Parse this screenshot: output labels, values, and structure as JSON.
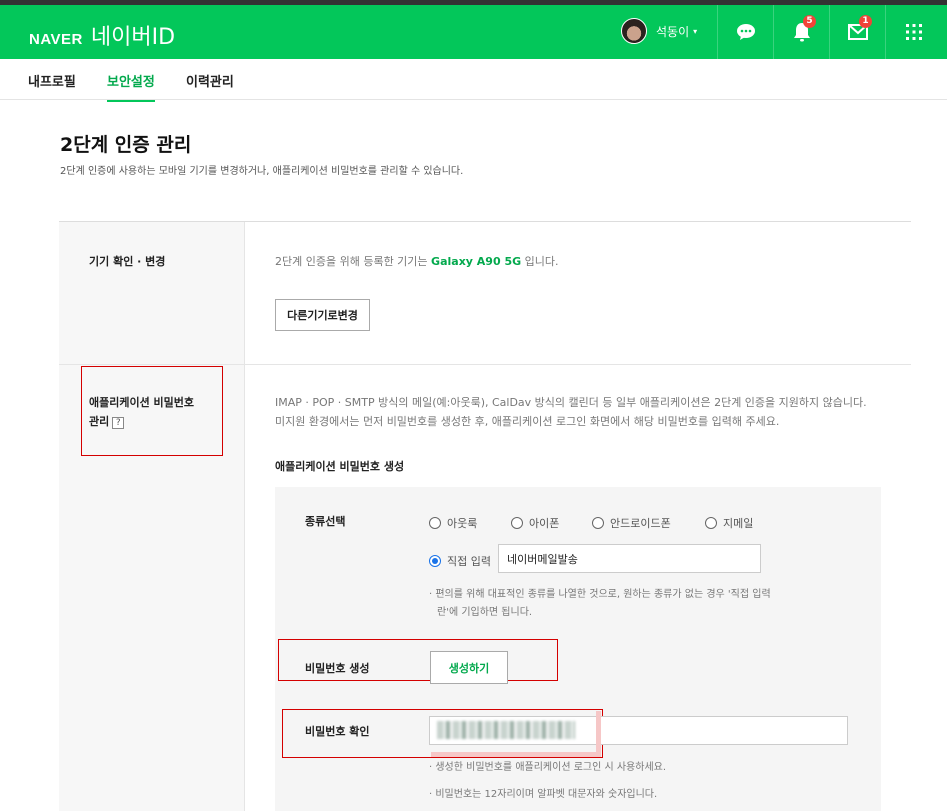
{
  "header": {
    "brand": "NAVER",
    "product": "네이버ID",
    "user_name": "석동이",
    "talk_badge": "",
    "notification_badge": "5",
    "mail_badge": "1",
    "colors": {
      "brand_green": "#03c75a",
      "badge_red": "#f04438"
    },
    "icons": [
      "talk-icon",
      "bell-icon",
      "mail-icon",
      "apps-grid-icon"
    ]
  },
  "tabs": [
    {
      "label": "내프로필",
      "active": false
    },
    {
      "label": "보안설정",
      "active": true
    },
    {
      "label": "이력관리",
      "active": false
    }
  ],
  "page": {
    "title": "2단계 인증 관리",
    "description": "2단계 인증에 사용하는 모바일 기기를 변경하거나, 애플리케이션 비밀번호를 관리할 수 있습니다."
  },
  "device": {
    "label": "기기 확인 · 변경",
    "text_before": "2단계 인증을 위해 등록한 기기는 ",
    "device_name": "Galaxy A90 5G",
    "text_after": " 입니다.",
    "change_button": "다른기기로변경"
  },
  "app_password": {
    "label_line1": "애플리케이션 비밀번호",
    "label_line2": "관리",
    "help": "?",
    "info_line1": "IMAP · POP · SMTP 방식의 메일(예:아웃룩), CalDav 방식의 캘린더 등 일부 애플리케이션은 2단계 인증을 지원하지 않습니다.",
    "info_line2": "미지원 환경에서는 먼저 비밀번호를 생성한 후, 애플리케이션 로그인 화면에서 해당 비밀번호를 입력해 주세요.",
    "generate_heading": "애플리케이션 비밀번호 생성",
    "type_label": "종류선택",
    "options": [
      "아웃룩",
      "아이폰",
      "안드로이드폰",
      "지메일"
    ],
    "direct_option": "직접 입력",
    "direct_value": "네이버메일발송",
    "type_note_line1": "· 편의를 위해 대표적인 종류를 나열한 것으로, 원하는 종류가 없는 경우 '직접 입력",
    "type_note_line2": "란'에 기입하면 됩니다.",
    "generate_label": "비밀번호 생성",
    "generate_button": "생성하기",
    "confirm_label": "비밀번호 확인",
    "note1": "· 생성한 비밀번호를 애플리케이션 로그인 시 사용하세요.",
    "note2": "· 비밀번호는 12자리이며 알파벳 대문자와 숫자입니다."
  }
}
